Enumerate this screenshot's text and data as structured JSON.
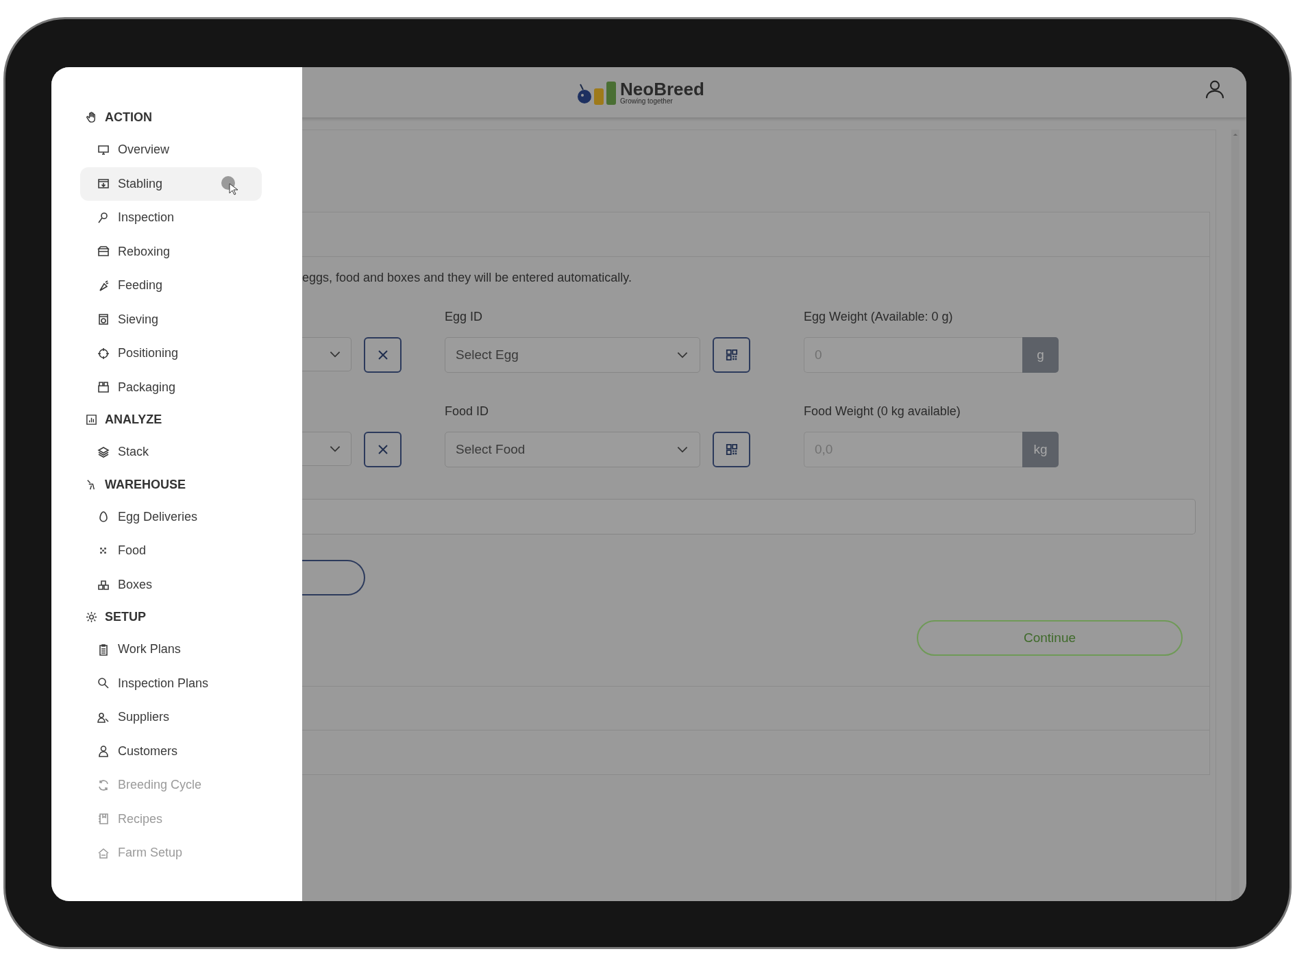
{
  "header": {
    "brand": "NeoBreed",
    "tagline": "Growing together"
  },
  "sidebar": {
    "sections": [
      {
        "title": "ACTION",
        "items": [
          {
            "label": "Overview",
            "selected": false,
            "disabled": false
          },
          {
            "label": "Stabling",
            "selected": true,
            "disabled": false
          },
          {
            "label": "Inspection",
            "selected": false,
            "disabled": false
          },
          {
            "label": "Reboxing",
            "selected": false,
            "disabled": false
          },
          {
            "label": "Feeding",
            "selected": false,
            "disabled": false
          },
          {
            "label": "Sieving",
            "selected": false,
            "disabled": false
          },
          {
            "label": "Positioning",
            "selected": false,
            "disabled": false
          },
          {
            "label": "Packaging",
            "selected": false,
            "disabled": false
          }
        ]
      },
      {
        "title": "ANALYZE",
        "items": [
          {
            "label": "Stack",
            "selected": false,
            "disabled": false
          }
        ]
      },
      {
        "title": "WAREHOUSE",
        "items": [
          {
            "label": "Egg Deliveries",
            "selected": false,
            "disabled": false
          },
          {
            "label": "Food",
            "selected": false,
            "disabled": false
          },
          {
            "label": "Boxes",
            "selected": false,
            "disabled": false
          }
        ]
      },
      {
        "title": "SETUP",
        "items": [
          {
            "label": "Work Plans",
            "selected": false,
            "disabled": false
          },
          {
            "label": "Inspection Plans",
            "selected": false,
            "disabled": false
          },
          {
            "label": "Suppliers",
            "selected": false,
            "disabled": false
          },
          {
            "label": "Customers",
            "selected": false,
            "disabled": false
          },
          {
            "label": "Breeding Cycle",
            "selected": false,
            "disabled": true
          },
          {
            "label": "Recipes",
            "selected": false,
            "disabled": true
          },
          {
            "label": "Farm Setup",
            "selected": false,
            "disabled": true
          }
        ]
      }
    ]
  },
  "form": {
    "description": "eggs, food and boxes and they will be entered automatically.",
    "rows": [
      {
        "label": "Egg ID",
        "placeholder": "Select Egg",
        "weight_label": "Egg Weight (Available: 0 g)",
        "weight_placeholder": "0",
        "unit": "g"
      },
      {
        "label": "Food ID",
        "placeholder": "Select Food",
        "weight_label": "Food Weight (0 kg available)",
        "weight_placeholder": "0,0",
        "unit": "kg"
      }
    ]
  },
  "continue_button": "Continue"
}
